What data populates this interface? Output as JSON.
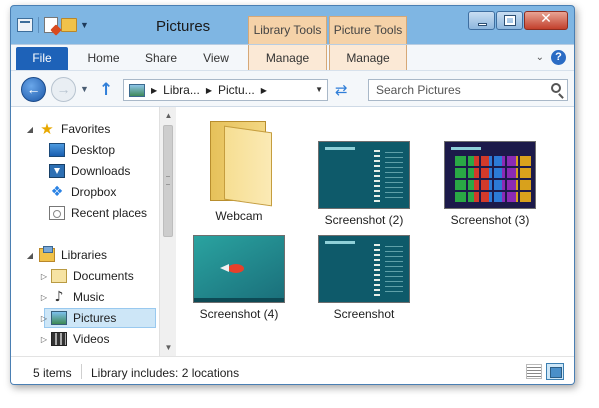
{
  "window": {
    "title": "Pictures",
    "contextual_tabs": [
      "Library Tools",
      "Picture Tools"
    ]
  },
  "ribbon": {
    "tabs": [
      {
        "label": "File"
      },
      {
        "label": "Home"
      },
      {
        "label": "Share"
      },
      {
        "label": "View"
      },
      {
        "label": "Manage"
      },
      {
        "label": "Manage"
      }
    ]
  },
  "navbar": {
    "breadcrumbs": [
      "Libra...",
      "Pictu..."
    ],
    "search_placeholder": "Search Pictures"
  },
  "navpane": {
    "favorites": {
      "label": "Favorites",
      "items": [
        "Desktop",
        "Downloads",
        "Dropbox",
        "Recent places"
      ]
    },
    "libraries": {
      "label": "Libraries",
      "items": [
        "Documents",
        "Music",
        "Pictures",
        "Videos"
      ],
      "selected": "Pictures"
    }
  },
  "files": [
    {
      "name": "Webcam",
      "kind": "folder"
    },
    {
      "name": "Screenshot (2)",
      "kind": "image"
    },
    {
      "name": "Screenshot (3)",
      "kind": "image"
    },
    {
      "name": "Screenshot (4)",
      "kind": "image"
    },
    {
      "name": "Screenshot",
      "kind": "image"
    }
  ],
  "statusbar": {
    "item_count": "5 items",
    "library_info": "Library includes: 2 locations"
  },
  "colors": {
    "frame": "#7fb6e3",
    "file_tab": "#1e62b8",
    "contextual_tab": "#f5d2a8",
    "selection": "#cde6f7"
  }
}
